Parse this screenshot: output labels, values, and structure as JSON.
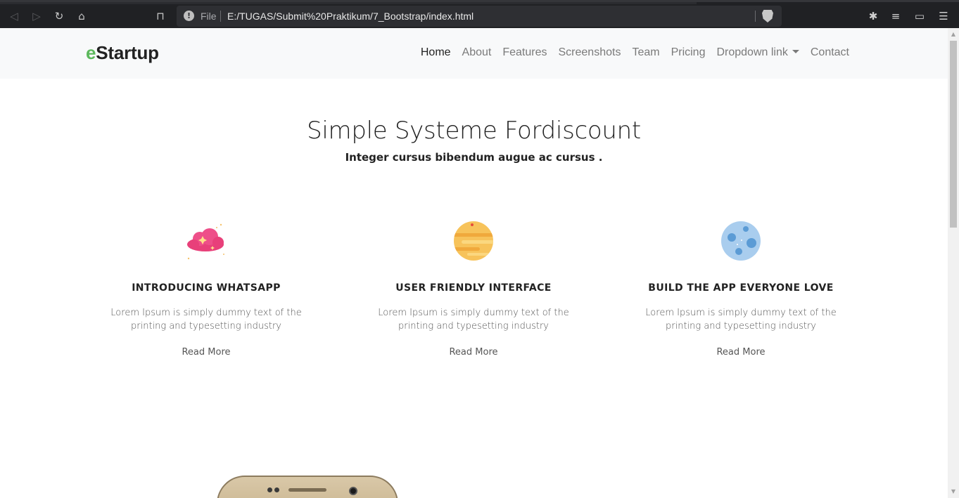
{
  "browser": {
    "file_label": "File",
    "url": "E:/TUGAS/Submit%20Praktikum/7_Bootstrap/index.html",
    "icons": [
      "back-icon",
      "forward-icon",
      "reload-icon",
      "home-icon",
      "bookmark-icon",
      "info-icon",
      "brave-shield-icon",
      "extensions-icon",
      "playlist-icon",
      "wallet-icon",
      "menu-icon"
    ]
  },
  "navbar": {
    "brand_accent": "e",
    "brand_rest": "Startup",
    "links": [
      "Home",
      "About",
      "Features",
      "Screenshots",
      "Team",
      "Pricing",
      "Dropdown link",
      "Contact"
    ]
  },
  "hero": {
    "title": "Simple Systeme Fordiscount",
    "subtitle": "Integer cursus bibendum augue ac cursus ."
  },
  "features": [
    {
      "icon": "cloud-icon",
      "title": "INTRODUCING WHATSAPP",
      "text": "Lorem Ipsum is simply dummy text of the printing and typesetting industry",
      "link": "Read More"
    },
    {
      "icon": "planet-icon",
      "title": "USER FRIENDLY INTERFACE",
      "text": "Lorem Ipsum is simply dummy text of the printing and typesetting industry",
      "link": "Read More"
    },
    {
      "icon": "moon-icon",
      "title": "BUILD THE APP EVERYONE LOVE",
      "text": "Lorem Ipsum is simply dummy text of the printing and typesetting industry",
      "link": "Read More"
    }
  ],
  "colors": {
    "brand_accent": "#5cb85c",
    "navbar_bg": "#f8f9fa",
    "chrome_bg": "#202124"
  }
}
